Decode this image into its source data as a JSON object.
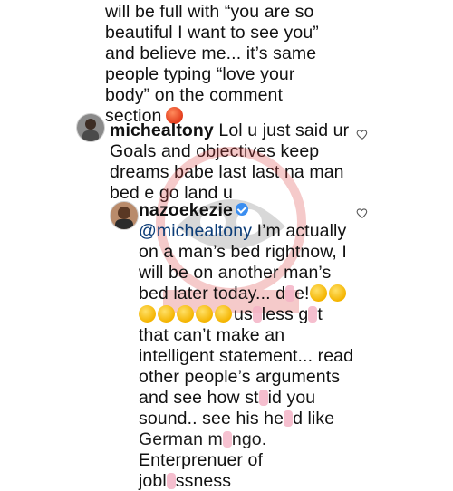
{
  "comments": {
    "first_tail": {
      "lines": [
        "will be full with “you are so",
        "beautiful I want to see you”",
        "and believe me... it’s same",
        "people typing “love your",
        "body” on the comment",
        "section"
      ],
      "end_emoji": "angry-face-emoji"
    },
    "reply1": {
      "username": "michealtony",
      "lines_after_username": [
        " Lol u just said ur"
      ],
      "lines": [
        "Goals and objectives keep",
        "dreams babe last last na man",
        "bed e go land u"
      ],
      "avatar": "avatar-michealtony",
      "like_icon": "heart-icon"
    },
    "reply2": {
      "username": "nazoekezie",
      "verified": true,
      "verified_icon": "verified-badge-icon",
      "mention": "@michealtony",
      "mention_rest": " I’m actually",
      "lines": [
        "on a man’s bed rightnow, I",
        "will be on another man’s",
        "bed later today... d",
        "e!",
        "us",
        "less g",
        "t",
        "that can’t make an",
        "intelligent statement... read",
        "other people’s arguments",
        "and see how st",
        "id you",
        "sound.. see his he",
        "d like",
        "German m",
        "ngo.",
        "Enterprenuer of",
        "jobl",
        "ssness"
      ],
      "avatar": "avatar-nazoekezie",
      "like_icon": "heart-icon",
      "emojis": "laughing-crying-face-emoji"
    }
  },
  "watermark": {
    "icon": "watermark-logo"
  },
  "colors": {
    "handle": "#0b3c77",
    "verified": "#3b8ef0",
    "censor": "#f3b3c6"
  }
}
